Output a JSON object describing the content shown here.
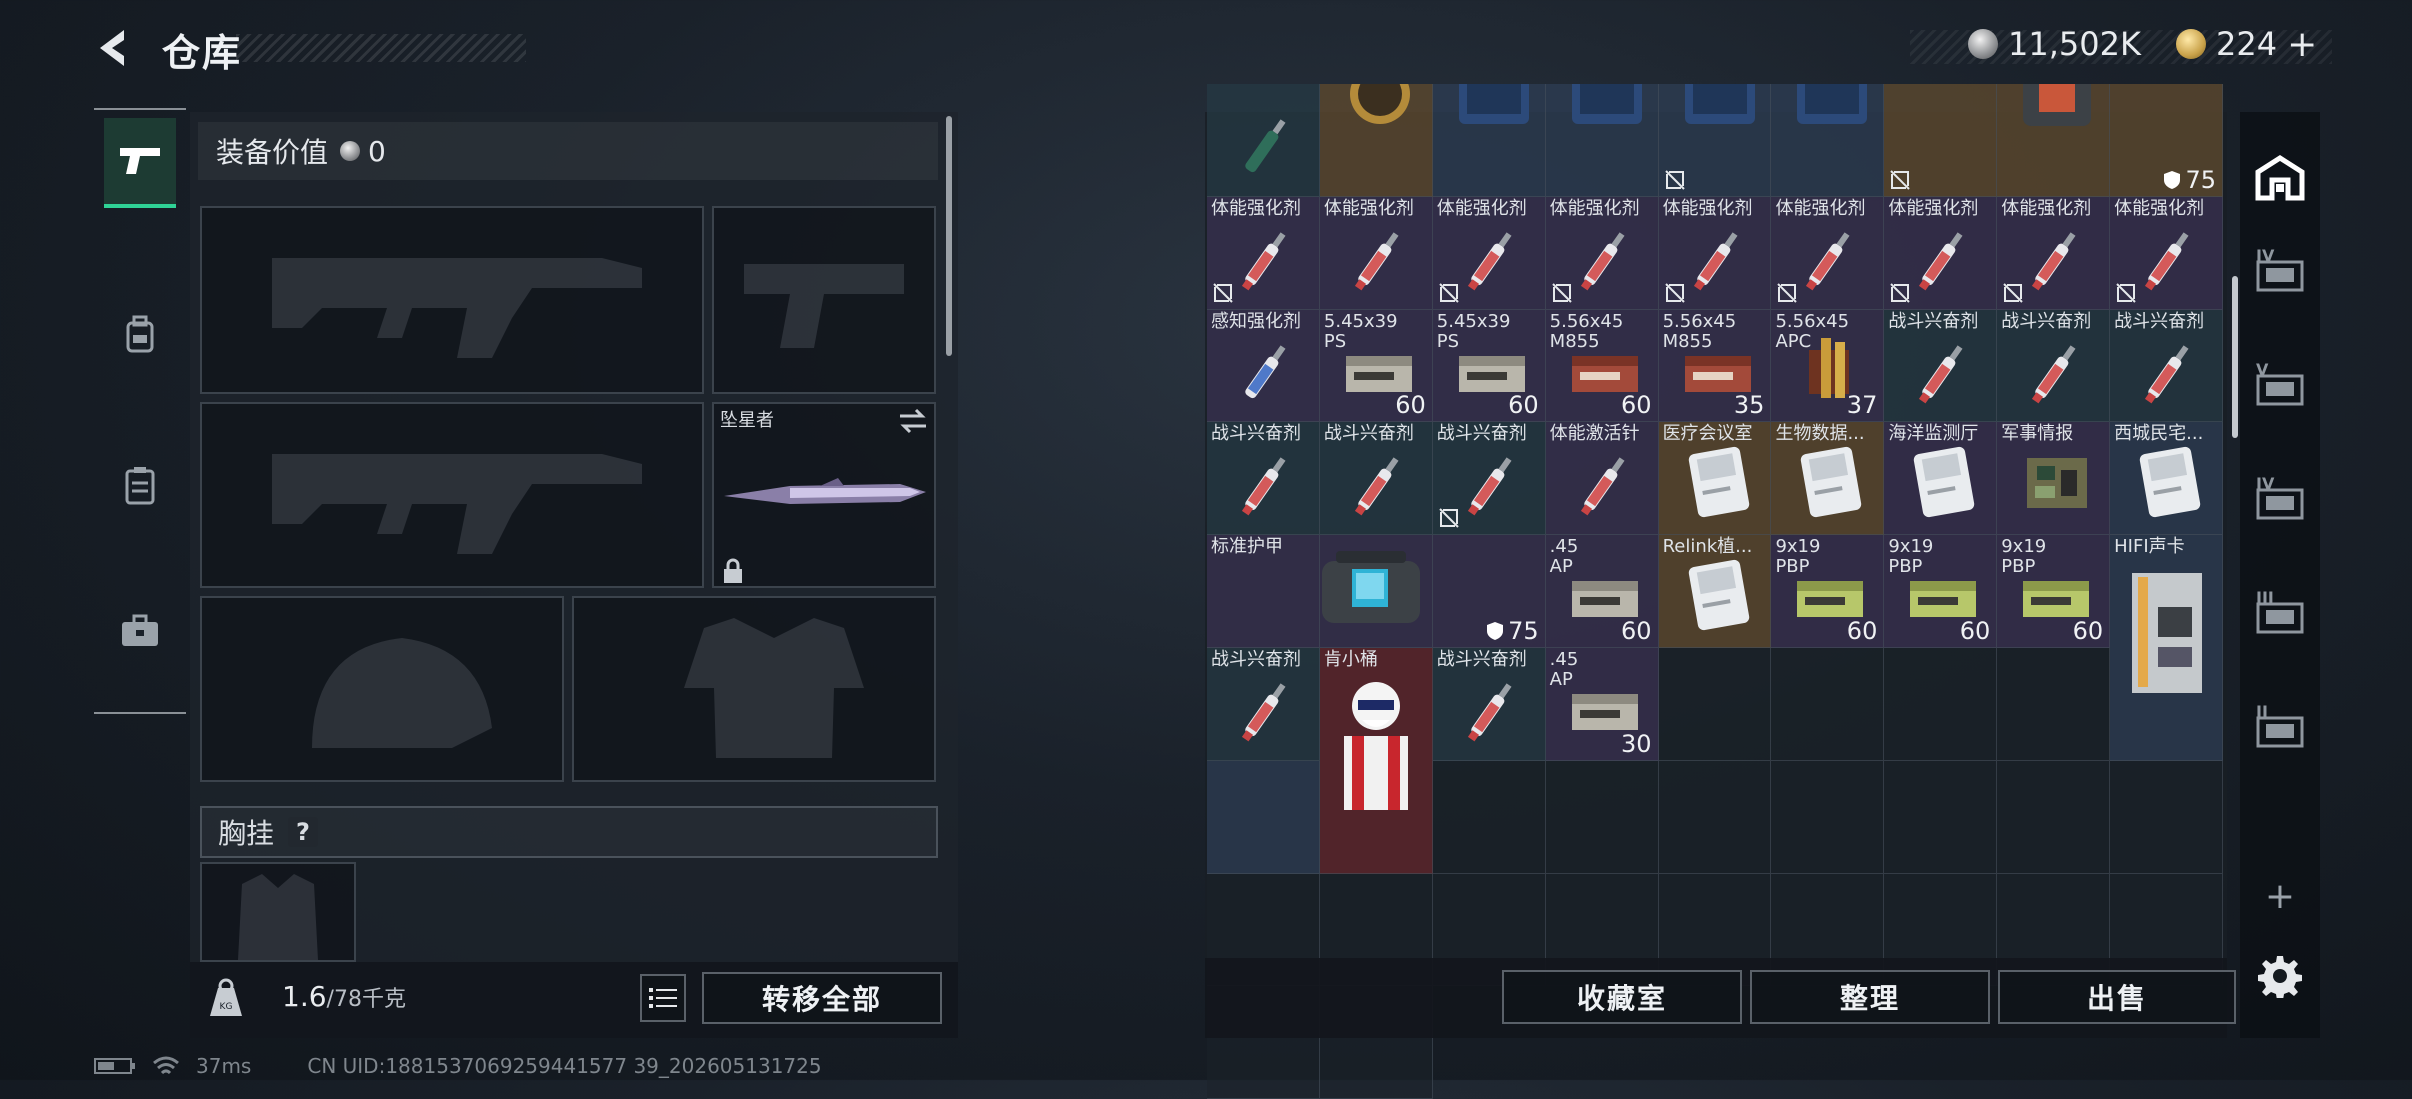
{
  "header": {
    "title": "仓库",
    "currency_1": "11,502K",
    "currency_2": "224",
    "currency_add": "+",
    "colors": {
      "accent_green": "#2fd396",
      "panel": "#1e242c"
    }
  },
  "equipment": {
    "value_label": "装备价值",
    "value": "0",
    "melee_name": "坠星者",
    "rig_label": "胸挂",
    "rig_help": "?",
    "weight": "1.6",
    "weight_max": "/78千克",
    "transfer_all": "转移全部"
  },
  "grid": {
    "cells": [
      {
        "name": "",
        "count": "",
        "lock": false,
        "bg": "teal",
        "art": "syringe-green"
      },
      {
        "name": "",
        "count": "",
        "lock": false,
        "bg": "gold",
        "art": "compass"
      },
      {
        "name": "",
        "count": "",
        "lock": false,
        "bg": "blue",
        "art": "case"
      },
      {
        "name": "",
        "count": "",
        "lock": false,
        "bg": "blue",
        "art": "case"
      },
      {
        "name": "",
        "count": "",
        "lock": true,
        "bg": "blue",
        "art": "case"
      },
      {
        "name": "",
        "count": "",
        "lock": false,
        "bg": "blue",
        "art": "case"
      },
      {
        "name": "",
        "count": "",
        "lock": true,
        "bg": "gold",
        "art": "none"
      },
      {
        "name": "",
        "count": "",
        "lock": false,
        "bg": "gold",
        "art": "armor-case"
      },
      {
        "name": "",
        "count": "75",
        "lock": false,
        "bg": "gold",
        "art": "none",
        "shield": true
      },
      {
        "name": "体能强化剂",
        "count": "",
        "lock": true,
        "bg": "purple",
        "art": "syringe-red"
      },
      {
        "name": "体能强化剂",
        "count": "",
        "lock": false,
        "bg": "purple",
        "art": "syringe-red"
      },
      {
        "name": "体能强化剂",
        "count": "",
        "lock": true,
        "bg": "purple",
        "art": "syringe-red"
      },
      {
        "name": "体能强化剂",
        "count": "",
        "lock": true,
        "bg": "purple",
        "art": "syringe-red"
      },
      {
        "name": "体能强化剂",
        "count": "",
        "lock": true,
        "bg": "purple",
        "art": "syringe-red"
      },
      {
        "name": "体能强化剂",
        "count": "",
        "lock": true,
        "bg": "purple",
        "art": "syringe-red"
      },
      {
        "name": "体能强化剂",
        "count": "",
        "lock": true,
        "bg": "purple",
        "art": "syringe-red"
      },
      {
        "name": "体能强化剂",
        "count": "",
        "lock": true,
        "bg": "purple",
        "art": "syringe-red"
      },
      {
        "name": "体能强化剂",
        "count": "",
        "lock": true,
        "bg": "purple",
        "art": "syringe-red"
      },
      {
        "name": "感知强化剂",
        "count": "",
        "lock": false,
        "bg": "purple",
        "art": "syringe-blue"
      },
      {
        "name": "5.45x39",
        "name2": "PS",
        "count": "60",
        "lock": false,
        "bg": "purple",
        "art": "ammo-gray"
      },
      {
        "name": "5.45x39",
        "name2": "PS",
        "count": "60",
        "lock": false,
        "bg": "purple",
        "art": "ammo-gray"
      },
      {
        "name": "5.56x45",
        "name2": "M855",
        "count": "60",
        "lock": false,
        "bg": "purple",
        "art": "ammo-red"
      },
      {
        "name": "5.56x45",
        "name2": "M855",
        "count": "35",
        "lock": false,
        "bg": "purple",
        "art": "ammo-red"
      },
      {
        "name": "5.56x45",
        "name2": "APC",
        "count": "37",
        "lock": false,
        "bg": "purple",
        "art": "ammo-gold"
      },
      {
        "name": "战斗兴奋剂",
        "count": "",
        "lock": false,
        "bg": "teal",
        "art": "syringe-red"
      },
      {
        "name": "战斗兴奋剂",
        "count": "",
        "lock": false,
        "bg": "teal",
        "art": "syringe-red"
      },
      {
        "name": "战斗兴奋剂",
        "count": "",
        "lock": false,
        "bg": "teal",
        "art": "syringe-red"
      },
      {
        "name": "战斗兴奋剂",
        "count": "",
        "lock": false,
        "bg": "teal",
        "art": "syringe-red"
      },
      {
        "name": "战斗兴奋剂",
        "count": "",
        "lock": false,
        "bg": "teal",
        "art": "syringe-red"
      },
      {
        "name": "战斗兴奋剂",
        "count": "",
        "lock": true,
        "bg": "teal",
        "art": "syringe-red"
      },
      {
        "name": "体能激活针",
        "count": "",
        "lock": false,
        "bg": "purple",
        "art": "syringe-red"
      },
      {
        "name": "医疗会议室",
        "count": "",
        "lock": false,
        "bg": "gold",
        "art": "keycard"
      },
      {
        "name": "生物数据...",
        "count": "",
        "lock": false,
        "bg": "gold",
        "art": "keycard"
      },
      {
        "name": "海洋监测厅",
        "count": "",
        "lock": false,
        "bg": "purple",
        "art": "keycard"
      },
      {
        "name": "军事情报",
        "count": "",
        "lock": false,
        "bg": "purple",
        "art": "chip"
      },
      {
        "name": "西城民宅...",
        "count": "",
        "lock": false,
        "bg": "blue",
        "art": "keycard"
      },
      {
        "name": "标准护甲",
        "count": "",
        "lock": false,
        "bg": "purple",
        "art": "none"
      },
      {
        "name": "",
        "count": "",
        "lock": false,
        "bg": "purple",
        "art": "bag"
      },
      {
        "name": "",
        "count": "75",
        "lock": false,
        "bg": "purple",
        "art": "none",
        "shield": true
      },
      {
        "name": ".45",
        "name2": "AP",
        "count": "60",
        "lock": false,
        "bg": "purple",
        "art": "ammo-gray"
      },
      {
        "name": "Relink植...",
        "count": "",
        "lock": false,
        "bg": "gold",
        "art": "keycard"
      },
      {
        "name": "9x19",
        "name2": "PBP",
        "count": "60",
        "lock": false,
        "bg": "purple",
        "art": "ammo-green"
      },
      {
        "name": "9x19",
        "name2": "PBP",
        "count": "60",
        "lock": false,
        "bg": "purple",
        "art": "ammo-green"
      },
      {
        "name": "9x19",
        "name2": "PBP",
        "count": "60",
        "lock": false,
        "bg": "purple",
        "art": "ammo-green"
      },
      {
        "name": "HIFI声卡",
        "count": "",
        "lock": false,
        "bg": "blue",
        "art": "soundcard"
      },
      {
        "name": "战斗兴奋剂",
        "count": "",
        "lock": false,
        "bg": "teal",
        "art": "syringe-red"
      },
      {
        "name": "肯小桶",
        "count": "",
        "lock": false,
        "bg": "red",
        "art": "kfc"
      },
      {
        "name": "战斗兴奋剂",
        "count": "",
        "lock": false,
        "bg": "teal",
        "art": "syringe-red"
      },
      {
        "name": ".45",
        "name2": "AP",
        "count": "30",
        "lock": false,
        "bg": "purple",
        "art": "ammo-gray"
      },
      {
        "name": "",
        "count": "",
        "lock": false,
        "bg": "dark",
        "art": "none"
      },
      {
        "name": "",
        "count": "",
        "lock": false,
        "bg": "dark",
        "art": "none"
      },
      {
        "name": "",
        "count": "",
        "lock": false,
        "bg": "dark",
        "art": "none"
      },
      {
        "name": "",
        "count": "",
        "lock": false,
        "bg": "dark",
        "art": "none"
      },
      {
        "name": "",
        "count": "",
        "lock": false,
        "bg": "blue",
        "art": "none"
      }
    ]
  },
  "storage_buttons": {
    "collection": "收藏室",
    "organize": "整理",
    "sell": "出售"
  },
  "status": {
    "ping": "37ms",
    "uid": "CN UID:1881537069259441577 39_202605131725"
  },
  "right_nav": [
    "IV",
    "V",
    "IV",
    "III",
    "II"
  ]
}
